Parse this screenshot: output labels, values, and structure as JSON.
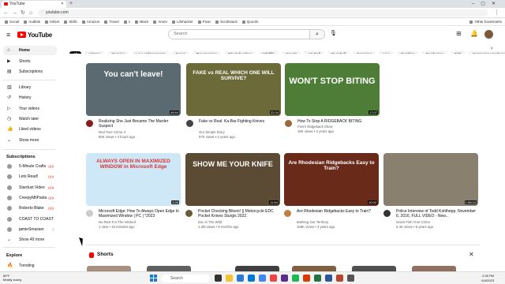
{
  "browser": {
    "tab_title": "YouTube",
    "url": "youtube.com",
    "bookmarks": [
      "Social",
      "Audible",
      "bitGet",
      "Skills",
      "Amazon",
      "Travel",
      "1",
      "Black",
      "Amen",
      "Lifehacker",
      "Pixar",
      "Scrollstack",
      "Qooofo",
      "Other bookmarks"
    ]
  },
  "header": {
    "logo_text": "YouTube",
    "search_placeholder": "Search"
  },
  "sidebar": {
    "main": [
      {
        "label": "Home",
        "icon": "home-icon"
      },
      {
        "label": "Shorts",
        "icon": "shorts-icon"
      },
      {
        "label": "Subscriptions",
        "icon": "subscriptions-icon"
      }
    ],
    "library": [
      {
        "label": "Library",
        "icon": "library-icon"
      },
      {
        "label": "History",
        "icon": "history-icon"
      },
      {
        "label": "Your videos",
        "icon": "your-videos-icon"
      },
      {
        "label": "Watch later",
        "icon": "watch-later-icon"
      },
      {
        "label": "Liked videos",
        "icon": "liked-icon"
      },
      {
        "label": "Show more",
        "icon": "chevron-down-icon"
      }
    ],
    "subscriptions_title": "Subscriptions",
    "subscriptions": [
      {
        "label": "5-Minute Crafts",
        "live": "((•))"
      },
      {
        "label": "Lets Read!",
        "live": "((•))"
      },
      {
        "label": "Stardust Video",
        "live": "((•))"
      },
      {
        "label": "CreepyMilPasta",
        "live": "((•))"
      },
      {
        "label": "Roberto Blake",
        "live": "((•))"
      },
      {
        "label": "COAST TO COAST ...",
        "live": ""
      },
      {
        "label": "jamieSmasser",
        "live": "•"
      }
    ],
    "show_more_subs": "Show 49 more",
    "explore_title": "Explore",
    "explore": [
      {
        "label": "Trending",
        "icon": "trending-icon"
      }
    ]
  },
  "chips": [
    "All",
    "History",
    "Gaming",
    "Law enforcement",
    "News",
    "Dog training",
    "Ghost hunting",
    "Wildlife",
    "Courts",
    "Art Bell",
    "Baseball",
    "Camping",
    "Live",
    "Reptiles",
    "Gardening",
    "Fish",
    "Computer Hardware"
  ],
  "videos": [
    {
      "title": "Realizing She Just Became The Murder Suspect",
      "channel": "Red Tree Crime ✔",
      "stats": "80K views • 4 hours ago",
      "duration": "49:54",
      "thumb_text": "You can't leave!",
      "thumb_bg": "#5a6a70",
      "av": "#8b1a1a"
    },
    {
      "title": "Fake vs Real: Ka-Bar Fighting Knives",
      "channel": "Our Simple Story",
      "stats": "57K views • 2 years ago",
      "duration": "22:34",
      "thumb_text": "FAKE vs REAL WHICH ONE WILL SURVIVE?",
      "thumb_bg": "#6d6a3a",
      "av": "#444"
    },
    {
      "title": "How To Stop A RIDGEBACK BITING",
      "channel": "Fenrir Ridgeback Show",
      "stats": "18K views • 2 years ago",
      "duration": "17:07",
      "thumb_text": "WON'T STOP BITING",
      "thumb_bg": "#4d7d36",
      "av": "#9c6a3a"
    },
    {
      "title": "Microsoft Edge: How To Always Open Edge In Maximized Window | PC | *2023",
      "channel": "No Rest For The Wicked",
      "stats": "1 view • 16 minutes ago",
      "duration": "2:26",
      "thumb_text": "ALWAYS OPEN IN MAXIMIZED WINDOW in Microsoft Edge",
      "thumb_bg": "#cfe8f8",
      "av": "#ccc"
    },
    {
      "title": "Pocket Checking Bikers! || Motorcycle EDC Pocket Knives Sturgis 2022.",
      "channel": "Zac In The Wild",
      "stats": "1.3M views • 9 months ago",
      "duration": "11:54",
      "thumb_text": "SHOW ME YOUR KNIFE",
      "thumb_bg": "#5b4a34",
      "av": "#6b5a3a"
    },
    {
      "title": "Are Rhodesian Ridgebacks Easy to Train?",
      "channel": "Marking Our Territory",
      "stats": "158K views • 3 years ago",
      "duration": "10:02",
      "thumb_text": "Are Rhodesian Ridgebacks Easy to Train?",
      "thumb_bg": "#6a2a1a",
      "av": "#c08040"
    },
    {
      "title": "Police Interview of Todd Kohlhepp, November 6, 2016, FULL VIDEO - New...",
      "channel": "Gavin Fish True Crime",
      "stats": "6.4K views • 5 years ago",
      "duration": "1:56:04",
      "thumb_text": "",
      "thumb_bg": "#8a8070",
      "av": "#333"
    }
  ],
  "shorts_title": "Shorts",
  "taskbar": {
    "weather_temp": "89°F",
    "weather_desc": "Mostly sunny",
    "search_label": "Search",
    "time": "2:35 PM",
    "date": "6/4/2023"
  }
}
